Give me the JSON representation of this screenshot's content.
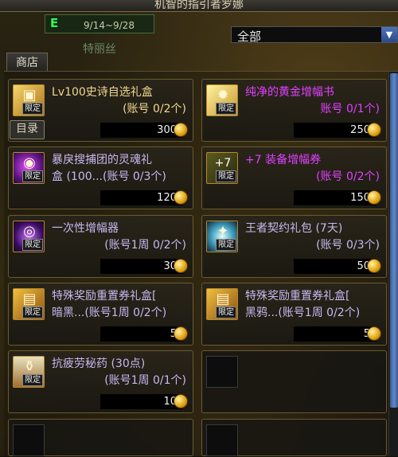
{
  "header": {
    "title": "机智的指引者罗娜"
  },
  "event": {
    "badge_icon": "e-icon",
    "date_range": "9/14~9/28"
  },
  "npc": {
    "name": "特丽丝"
  },
  "filter": {
    "selected": "全部",
    "arrow_icon": "chevron-down-icon"
  },
  "tabs": {
    "shop": "商店",
    "directory": "目录"
  },
  "colors": {
    "gold": "#f0d890",
    "lavender": "#c8b8f0",
    "magenta": "#e040ff",
    "price_red": "#ff4030"
  },
  "items": [
    {
      "name": "Lv100史诗自选礼盒",
      "limit": "(账号 0/2个)",
      "price": "300",
      "price_color": "red",
      "name_color": "gold",
      "badge": "限定",
      "icon": "gold-box-icon"
    },
    {
      "name": "纯净的黄金增幅书",
      "limit": "账号 0/1个)",
      "price": "250",
      "price_color": "white",
      "name_color": "mag",
      "badge": "限定",
      "icon": "amplify-book-icon"
    },
    {
      "name": "暴戾搜捕团的灵魂礼",
      "name2": "盒 (100...(账号 0/3个)",
      "limit": "",
      "price": "120",
      "price_color": "white",
      "name_color": "lav",
      "badge": "限定",
      "icon": "soul-box-icon"
    },
    {
      "name": "+7 装备增幅券",
      "limit": "(账号 0/2个)",
      "price": "150",
      "price_color": "white",
      "name_color": "mag",
      "badge": "限定",
      "icon": "plus7-ticket-icon"
    },
    {
      "name": "一次性增幅器",
      "limit": "(账号1周 0/2个)",
      "price": "30",
      "price_color": "white",
      "name_color": "lav",
      "badge": "限定",
      "icon": "amplifier-icon"
    },
    {
      "name": "王者契约礼包 (7天)",
      "limit": "(账号 0/3个)",
      "price": "50",
      "price_color": "white",
      "name_color": "lav",
      "badge": "限定",
      "icon": "contract-icon"
    },
    {
      "name": "特殊奖励重置券礼盒[",
      "name2": "暗黑...(账号1周 0/2个)",
      "limit": "",
      "price": "5",
      "price_color": "white",
      "name_color": "lav",
      "badge": "限定",
      "icon": "reset-ticket-box-icon"
    },
    {
      "name": "特殊奖励重置券礼盒[",
      "name2": "黑鸦...(账号1周 0/2个)",
      "limit": "",
      "price": "5",
      "price_color": "white",
      "name_color": "lav",
      "badge": "限定",
      "icon": "reset-ticket-box-icon"
    },
    {
      "name": "抗疲劳秘药 (30点)",
      "limit": "(账号1周 0/1个)",
      "price": "10",
      "price_color": "white",
      "name_color": "lav",
      "badge": "限定",
      "icon": "potion-icon"
    }
  ]
}
